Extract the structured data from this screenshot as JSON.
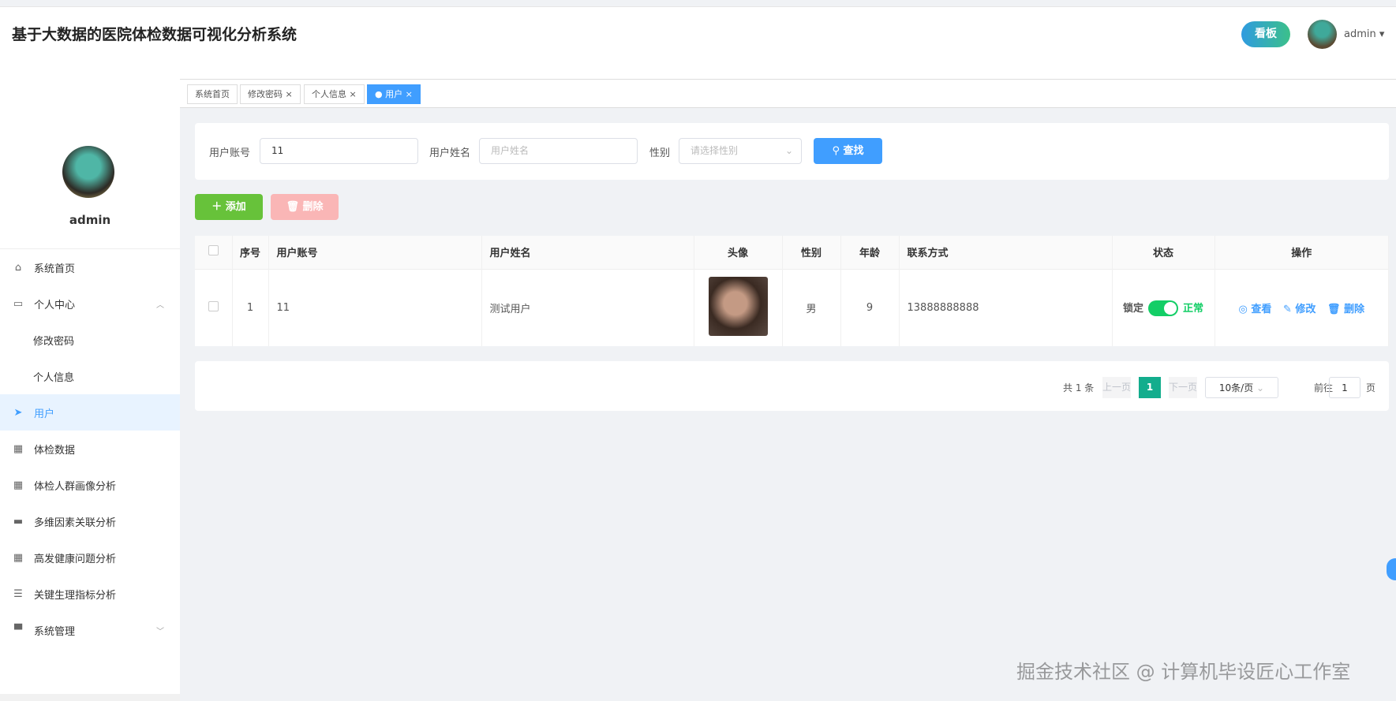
{
  "header": {
    "title": "基于大数据的医院体检数据可视化分析系统",
    "kanban": "看板",
    "username": "admin"
  },
  "sidebar": {
    "username": "admin",
    "items": [
      {
        "label": "系统首页",
        "icon": "home-icon"
      },
      {
        "label": "个人中心",
        "icon": "card-icon"
      },
      {
        "label": "修改密码"
      },
      {
        "label": "个人信息"
      },
      {
        "label": "用户",
        "icon": "send-icon"
      },
      {
        "label": "体检数据",
        "icon": "grid-icon"
      },
      {
        "label": "体检人群画像分析",
        "icon": "grid-icon"
      },
      {
        "label": "多维因素关联分析",
        "icon": "comment-icon"
      },
      {
        "label": "高发健康问题分析",
        "icon": "grid-icon"
      },
      {
        "label": "关键生理指标分析",
        "icon": "list-icon"
      },
      {
        "label": "系统管理",
        "icon": "server-icon"
      }
    ]
  },
  "tabs": [
    "系统首页",
    "修改密码",
    "个人信息",
    "用户"
  ],
  "search": {
    "account_label": "用户账号",
    "account_value": "11",
    "name_label": "用户姓名",
    "name_placeholder": "用户姓名",
    "gender_label": "性别",
    "gender_placeholder": "请选择性别",
    "search_btn": "查找"
  },
  "actions": {
    "add": "添加",
    "delete": "删除"
  },
  "table": {
    "headers": [
      "序号",
      "用户账号",
      "用户姓名",
      "头像",
      "性别",
      "年龄",
      "联系方式",
      "状态",
      "操作"
    ],
    "rows": [
      {
        "index": "1",
        "account": "11",
        "name": "测试用户",
        "gender": "男",
        "age": "9",
        "phone": "13888888888",
        "lock_label": "锁定",
        "status": "正常",
        "status_on": true,
        "view": "查看",
        "edit": "修改",
        "delete": "删除"
      }
    ]
  },
  "pagination": {
    "total": "共 1 条",
    "prev": "上一页",
    "current": "1",
    "next": "下一页",
    "page_size": "10条/页",
    "goto": "前往",
    "goto_value": "1",
    "page_unit": "页"
  },
  "watermark": "掘金技术社区 @ 计算机毕设匠心工作室"
}
